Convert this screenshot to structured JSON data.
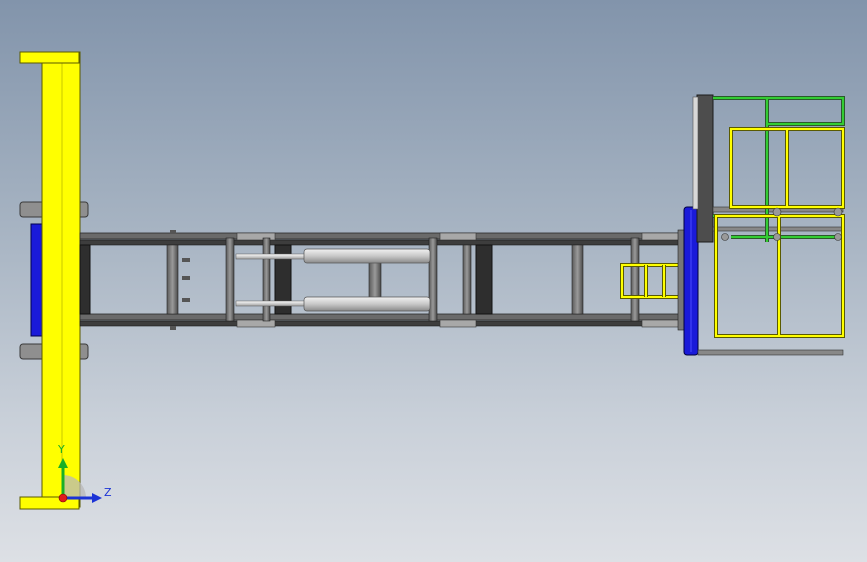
{
  "viewport": {
    "background_top": "#8294ab",
    "background_bottom": "#dde0e5"
  },
  "model": {
    "colors": {
      "yellow": "#ffff00",
      "yellow_edge": "#5a5a00",
      "green": "#33cc33",
      "blue": "#1a1ad9",
      "steel": "#4d4d4d",
      "steel_light": "#8c8c8c",
      "cylinder": "#d4d4d4"
    },
    "parts": [
      "boom-mast",
      "main-chassis-frame",
      "hydraulic-cylinder",
      "front-mount-plate",
      "ladder",
      "platform-guardrail"
    ]
  },
  "triad": {
    "y_label": "Y",
    "z_label": "Z",
    "icon": "axis-triad-icon"
  }
}
